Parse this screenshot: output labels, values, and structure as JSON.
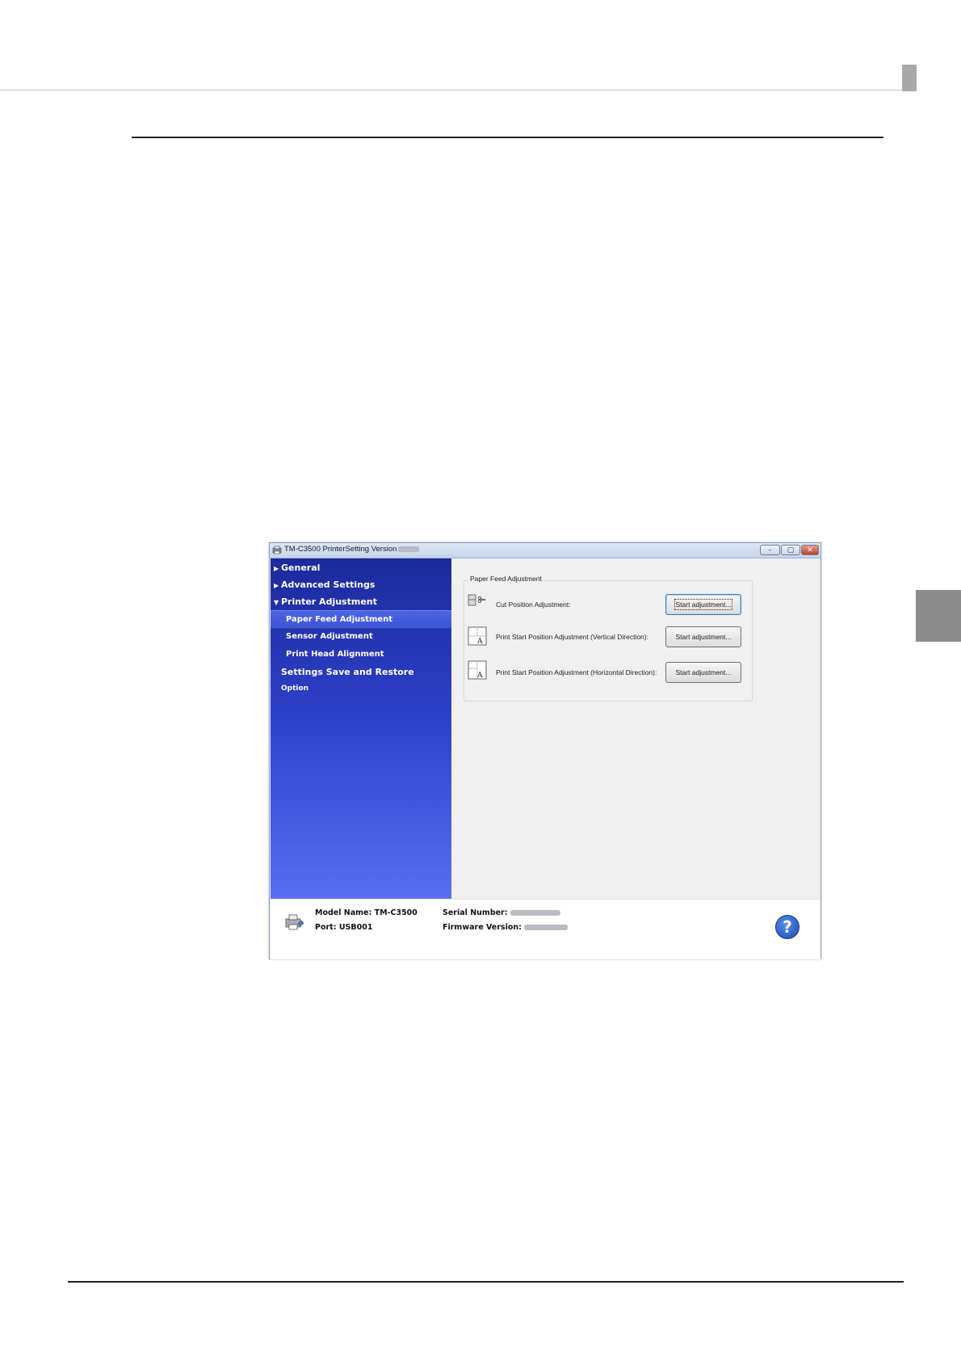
{
  "window": {
    "title": "TM-C3500 PrinterSetting Version",
    "controls": {
      "minimize": "–",
      "maximize": "▢",
      "close": "✕"
    }
  },
  "sidebar": {
    "items": [
      {
        "label": "General",
        "arrow": "▶"
      },
      {
        "label": "Advanced Settings",
        "arrow": "▶"
      },
      {
        "label": "Printer Adjustment",
        "arrow": "▼"
      },
      {
        "label": "Paper Feed Adjustment"
      },
      {
        "label": "Sensor Adjustment"
      },
      {
        "label": "Print Head Alignment"
      },
      {
        "label": "Settings Save and Restore"
      },
      {
        "label": "Option"
      }
    ]
  },
  "content": {
    "group_title": "Paper Feed Adjustment",
    "rows": [
      {
        "label": "Cut Position Adjustment:",
        "button": "Start adjustment..."
      },
      {
        "label": "Print Start Position Adjustment (Vertical Direction):",
        "button": "Start adjustment..."
      },
      {
        "label": "Print Start Position Adjustment (Horizontal Direction):",
        "button": "Start adjustment..."
      }
    ]
  },
  "statusbar": {
    "model_name_label": "Model Name:",
    "model_name_value": "TM-C3500",
    "port_label": "Port:",
    "port_value": "USB001",
    "serial_label": "Serial Number:",
    "firmware_label": "Firmware Version:",
    "help": "?"
  },
  "colors": {
    "sidebar_top": "#1d2a9c",
    "sidebar_bottom": "#5a6df2",
    "active_item": "#3c55d6",
    "help_button": "#1a48b0"
  },
  "icons": [
    "app-icon",
    "minimize-icon",
    "maximize-icon",
    "close-icon",
    "cut-position-icon",
    "vertical-position-icon",
    "horizontal-position-icon",
    "printer-icon",
    "help-icon"
  ]
}
